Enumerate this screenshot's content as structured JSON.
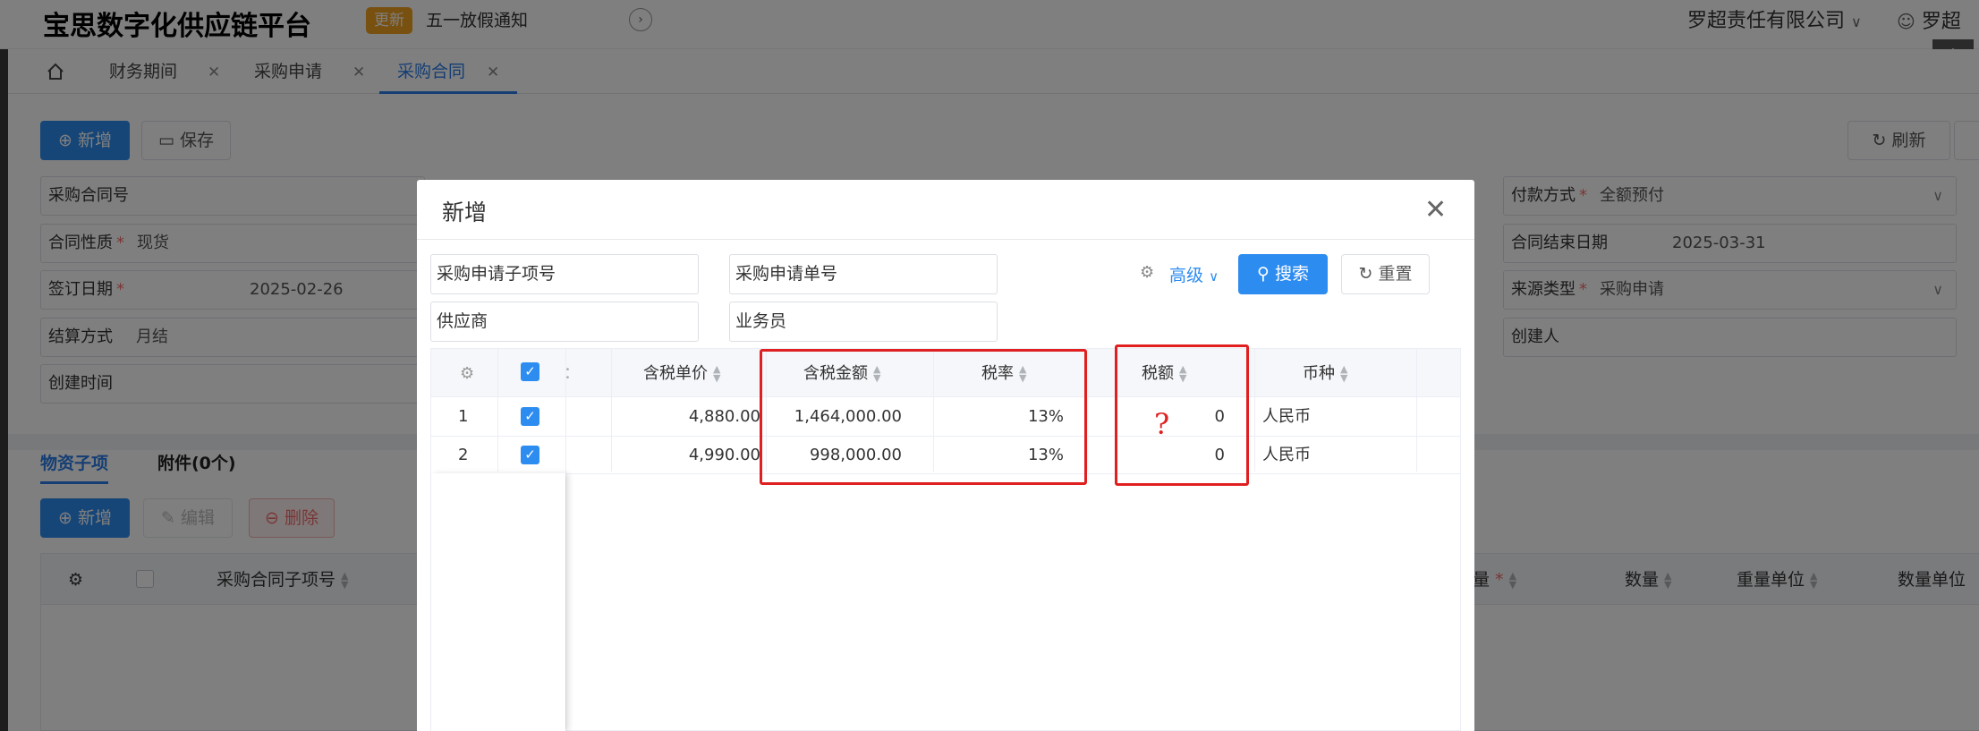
{
  "app": {
    "title": "宝思数字化供应链平台",
    "badge": "更新",
    "notice": "五一放假通知",
    "company": "罗超责任有限公司",
    "user": "罗超"
  },
  "tabs": [
    {
      "label": "财务期间"
    },
    {
      "label": "采购申请"
    },
    {
      "label": "采购合同"
    }
  ],
  "toolbar": {
    "add": "新增",
    "save": "保存",
    "refresh": "刷新"
  },
  "form": {
    "contract_no": "采购合同号",
    "contract_nature": "合同性质",
    "contract_nature_val": "现货",
    "sign_date": "签订日期",
    "sign_date_val": "2025-02-26",
    "settle": "结算方式",
    "settle_val": "月结",
    "created_time": "创建时间",
    "pay_method": "付款方式",
    "pay_method_val": "全额预付",
    "end_date": "合同结束日期",
    "end_date_val": "2025-03-31",
    "source_type": "来源类型",
    "source_type_val": "采购申请",
    "creator": "创建人"
  },
  "subtabs": {
    "items": "物资子项",
    "attachments": "附件(0个)"
  },
  "subtoolbar": {
    "add": "新增",
    "edit": "编辑",
    "delete": "删除"
  },
  "grid": {
    "col_sub_no": "采购合同子项号",
    "col_weight": "量",
    "col_qty": "数量",
    "col_weight_unit": "重量单位",
    "col_qty_unit": "数量单位"
  },
  "dialog": {
    "title": "新增",
    "f_sub_no": "采购申请子项号",
    "f_req_no": "采购申请单号",
    "f_supplier": "供应商",
    "f_salesman": "业务员",
    "advanced": "高级",
    "search": "搜索",
    "reset": "重置",
    "question_mark": "?",
    "columns": {
      "partial": "：",
      "unit_price": "含税单价",
      "amount": "含税金额",
      "rate": "税率",
      "tax": "税额",
      "currency": "币种"
    },
    "rows": [
      {
        "idx": "1",
        "unit_price": "4,880.00",
        "amount": "1,464,000.00",
        "rate": "13%",
        "tax": "0",
        "currency": "人民币"
      },
      {
        "idx": "2",
        "unit_price": "4,990.00",
        "amount": "998,000.00",
        "rate": "13%",
        "tax": "0",
        "currency": "人民币"
      }
    ]
  },
  "colors": {
    "primary": "#2d8cf0",
    "annotation_red": "#e02020",
    "badge": "#f0a020"
  }
}
